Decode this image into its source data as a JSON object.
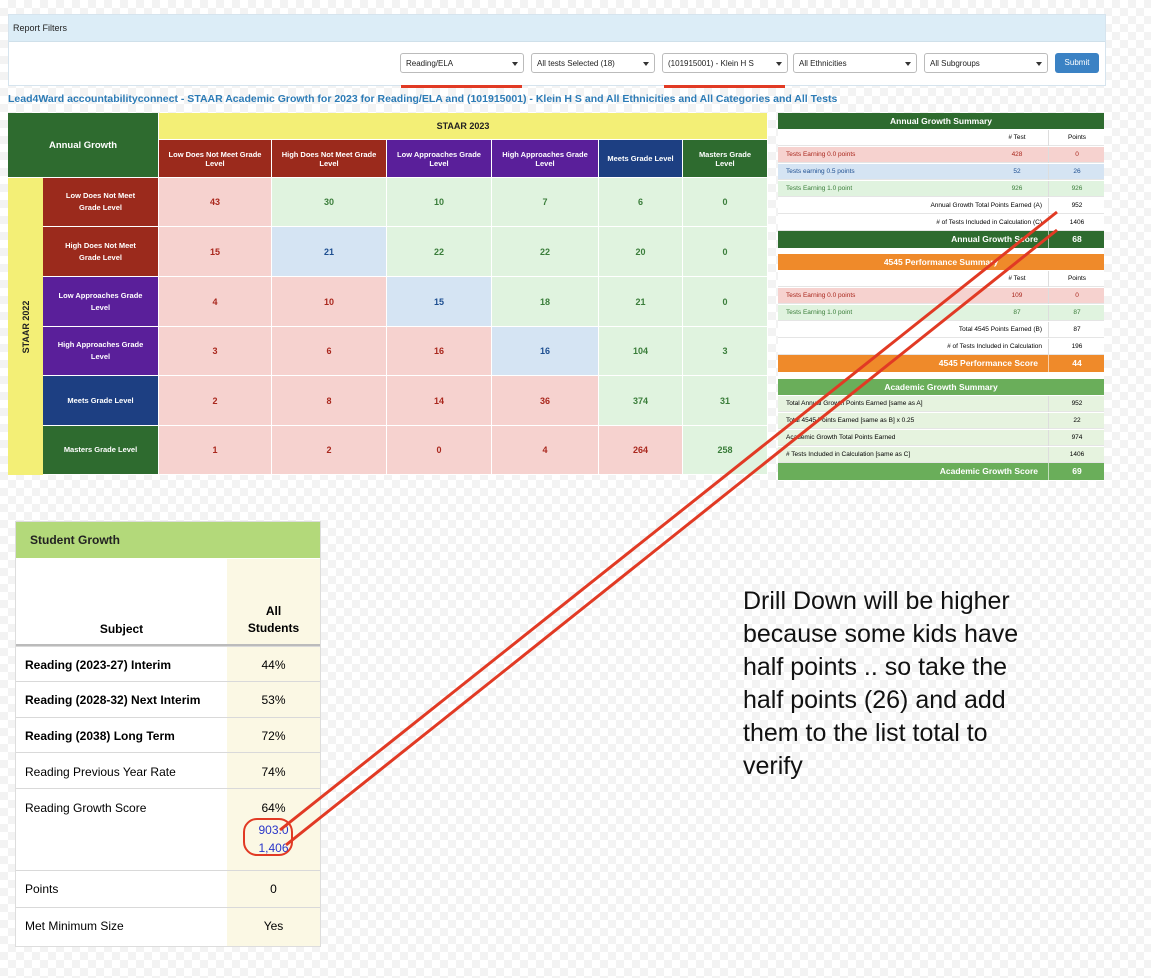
{
  "filters": {
    "title": "Report Filters",
    "subject": "Reading/ELA",
    "tests": "All tests Selected (18)",
    "campus": "(101915001) - Klein H S",
    "ethnicity": "All Ethnicities",
    "subgroup": "All Subgroups",
    "submit": "Submit"
  },
  "report_title": "Lead4Ward accountabilityconnect - STAAR Academic Growth for 2023 for Reading/ELA and (101915001) - Klein H S and All Ethnicities and All Categories and All Tests",
  "matrix": {
    "corner": "Annual Growth",
    "col_group": "STAAR 2023",
    "row_group": "STAAR 2022",
    "columns": [
      {
        "label": "Low Does Not Meet Grade Level",
        "color": "#9b2a1c"
      },
      {
        "label": "High Does Not Meet Grade Level",
        "color": "#9b2a1c"
      },
      {
        "label": "Low Approaches Grade Level",
        "color": "#5a1f9a"
      },
      {
        "label": "High Approaches Grade Level",
        "color": "#5a1f9a"
      },
      {
        "label": "Meets Grade Level",
        "color": "#1d3f82"
      },
      {
        "label": "Masters Grade Level",
        "color": "#2e6b2f"
      }
    ],
    "rows": [
      {
        "label": "Low Does Not Meet Grade Level",
        "color": "#9b2a1c",
        "values": [
          "43",
          "30",
          "10",
          "7",
          "6",
          "0"
        ],
        "shades": [
          "red",
          "green",
          "green",
          "green",
          "green",
          "green"
        ]
      },
      {
        "label": "High Does Not Meet Grade Level",
        "color": "#9b2a1c",
        "values": [
          "15",
          "21",
          "22",
          "22",
          "20",
          "0"
        ],
        "shades": [
          "red",
          "blue",
          "green",
          "green",
          "green",
          "green"
        ]
      },
      {
        "label": "Low Approaches Grade Level",
        "color": "#5a1f9a",
        "values": [
          "4",
          "10",
          "15",
          "18",
          "21",
          "0"
        ],
        "shades": [
          "red",
          "red",
          "blue",
          "green",
          "green",
          "green"
        ]
      },
      {
        "label": "High Approaches Grade Level",
        "color": "#5a1f9a",
        "values": [
          "3",
          "6",
          "16",
          "16",
          "104",
          "3"
        ],
        "shades": [
          "red",
          "red",
          "red",
          "blue",
          "green",
          "green"
        ]
      },
      {
        "label": "Meets Grade Level",
        "color": "#1d3f82",
        "values": [
          "2",
          "8",
          "14",
          "36",
          "374",
          "31"
        ],
        "shades": [
          "red",
          "red",
          "red",
          "red",
          "green",
          "green"
        ]
      },
      {
        "label": "Masters Grade Level",
        "color": "#2e6b2f",
        "values": [
          "1",
          "2",
          "0",
          "4",
          "264",
          "258"
        ],
        "shades": [
          "red",
          "red",
          "red",
          "red",
          "red",
          "green"
        ]
      }
    ]
  },
  "annual": {
    "title": "Annual Growth Summary",
    "col_test": "# Test",
    "col_points": "Points",
    "r1": {
      "label": "Tests Earning 0.0 points",
      "test": "428",
      "points": "0"
    },
    "r2": {
      "label": "Tests earning 0.5 points",
      "test": "52",
      "points": "26"
    },
    "r3": {
      "label": "Tests Earning 1.0 point",
      "test": "926",
      "points": "926"
    },
    "r4": {
      "label": "Annual Growth Total Points Earned (A)",
      "points": "952"
    },
    "r5": {
      "label": "# of Tests Included in Calculation (C)",
      "points": "1406"
    },
    "score_label": "Annual Growth Score",
    "score": "68"
  },
  "perf": {
    "title": "4545 Performance Summary",
    "col_test": "# Test",
    "col_points": "Points",
    "r1": {
      "label": "Tests Earning 0.0 points",
      "test": "109",
      "points": "0"
    },
    "r2": {
      "label": "Tests Earning 1.0 point",
      "test": "87",
      "points": "87"
    },
    "r3": {
      "label": "Total 4545 Points Earned (B)",
      "points": "87"
    },
    "r4": {
      "label": "# of Tests Included in Calculation",
      "points": "196"
    },
    "score_label": "4545 Performance Score",
    "score": "44"
  },
  "academic": {
    "title": "Academic Growth Summary",
    "r1": {
      "label": "Total Annual Growth Points Earned [same as A]",
      "points": "952"
    },
    "r2": {
      "label": "Total 4545 Points Earned [same as B] x 0.25",
      "points": "22"
    },
    "r3": {
      "label": "Academic Growth Total Points Earned",
      "points": "974"
    },
    "r4": {
      "label": "# Tests Included in Calculation [same as C]",
      "points": "1406"
    },
    "score_label": "Academic Growth Score",
    "score": "69"
  },
  "student_growth": {
    "title": "Student Growth",
    "col_subject": "Subject",
    "col_all_1": "All",
    "col_all_2": "Students",
    "rows": [
      {
        "label": "Reading (2023-27) Interim",
        "value": "44%"
      },
      {
        "label": "Reading (2028-32) Next Interim",
        "value": "53%"
      },
      {
        "label": "Reading (2038) Long Term",
        "value": "72%"
      },
      {
        "label": "Reading Previous Year Rate",
        "value": "74%"
      },
      {
        "label": "Reading Growth Score",
        "value": "64%",
        "sub1": "903.0",
        "sub2": "1,406"
      },
      {
        "label": "Points",
        "value": "0"
      },
      {
        "label": "Met Minimum Size",
        "value": "Yes"
      }
    ]
  },
  "note": "Drill Down will be higher because some kids have half points .. so take the half points (26) and add them to the list total to verify",
  "colors": {
    "annual_green": "#2e6b2f",
    "perf_orange": "#ef8a2a",
    "academic_green": "#6aae5a",
    "annotation_red": "#e13a24",
    "link_blue": "#2c7bb6"
  }
}
